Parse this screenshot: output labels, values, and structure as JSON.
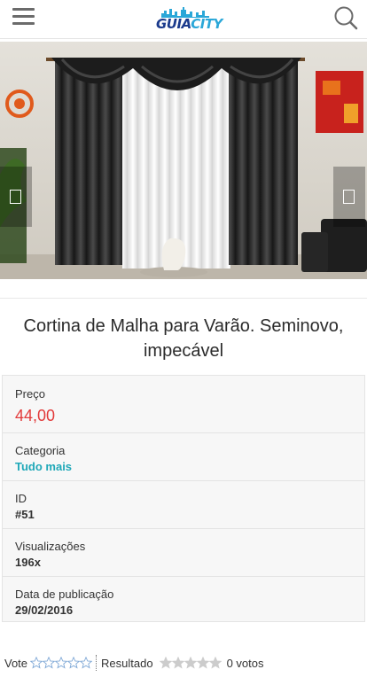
{
  "header": {
    "logo_text_a": "GUIA",
    "logo_text_b": "CITY",
    "menu_icon": "hamburger-menu-icon",
    "search_icon": "search-icon"
  },
  "gallery": {
    "prev_icon": "chevron-left-icon",
    "next_icon": "chevron-right-icon"
  },
  "listing": {
    "title": "Cortina de Malha para Varão. Seminovo, impecável"
  },
  "info": {
    "price_label": "Preço",
    "price_value": "44,00",
    "category_label": "Categoria",
    "category_value": "Tudo mais",
    "id_label": "ID",
    "id_value": "#51",
    "views_label": "Visualizações",
    "views_value": "196x",
    "date_label": "Data de publicação",
    "date_value": "29/02/2016"
  },
  "rating": {
    "vote_label": "Vote",
    "result_label": "Resultado",
    "votes_text": "0 votos",
    "vote_stars": 5,
    "result_stars": 5
  },
  "colors": {
    "price": "#e23a3a",
    "category_link": "#1fa8b8",
    "logo_dark": "#1a3a8c",
    "logo_light": "#2aa7d8",
    "star_outline": "#7fa8d6",
    "star_result": "#cccccc"
  }
}
